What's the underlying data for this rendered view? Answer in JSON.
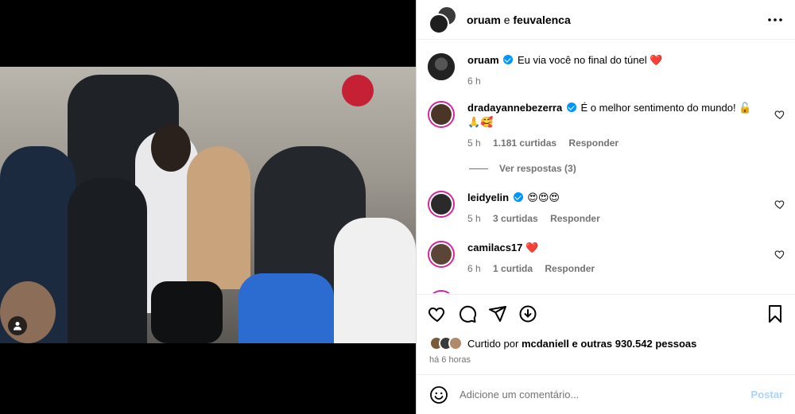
{
  "header": {
    "user1": "oruam",
    "separator": "e",
    "user2": "feuvalenca"
  },
  "caption": {
    "username": "oruam",
    "text": "Eu via você no final do túnel ❤️",
    "time": "6 h"
  },
  "comments": [
    {
      "username": "dradayannebezerra",
      "text": "É o melhor sentimento do mundo! 🔓🙏🥰",
      "time": "5 h",
      "likes": "1.181 curtidas",
      "reply": "Responder"
    },
    {
      "username": "leidyelin",
      "text": "😍😍😍",
      "time": "5 h",
      "likes": "3 curtidas",
      "reply": "Responder"
    },
    {
      "username": "camilacs17",
      "text": "❤️",
      "time": "6 h",
      "likes": "1 curtida",
      "reply": "Responder"
    }
  ],
  "view_replies": "Ver respostas (3)",
  "likes": {
    "prefix": "Curtido por",
    "user": "mcdaniell",
    "suffix": "e outras 930.542 pessoas"
  },
  "post_time": "há 6 horas",
  "comment_box": {
    "placeholder": "Adicione um comentário...",
    "post_label": "Postar"
  },
  "colors": {
    "accent": "#0095f6",
    "like_red": "#ed4956",
    "post_disabled": "#a8d4fb"
  }
}
